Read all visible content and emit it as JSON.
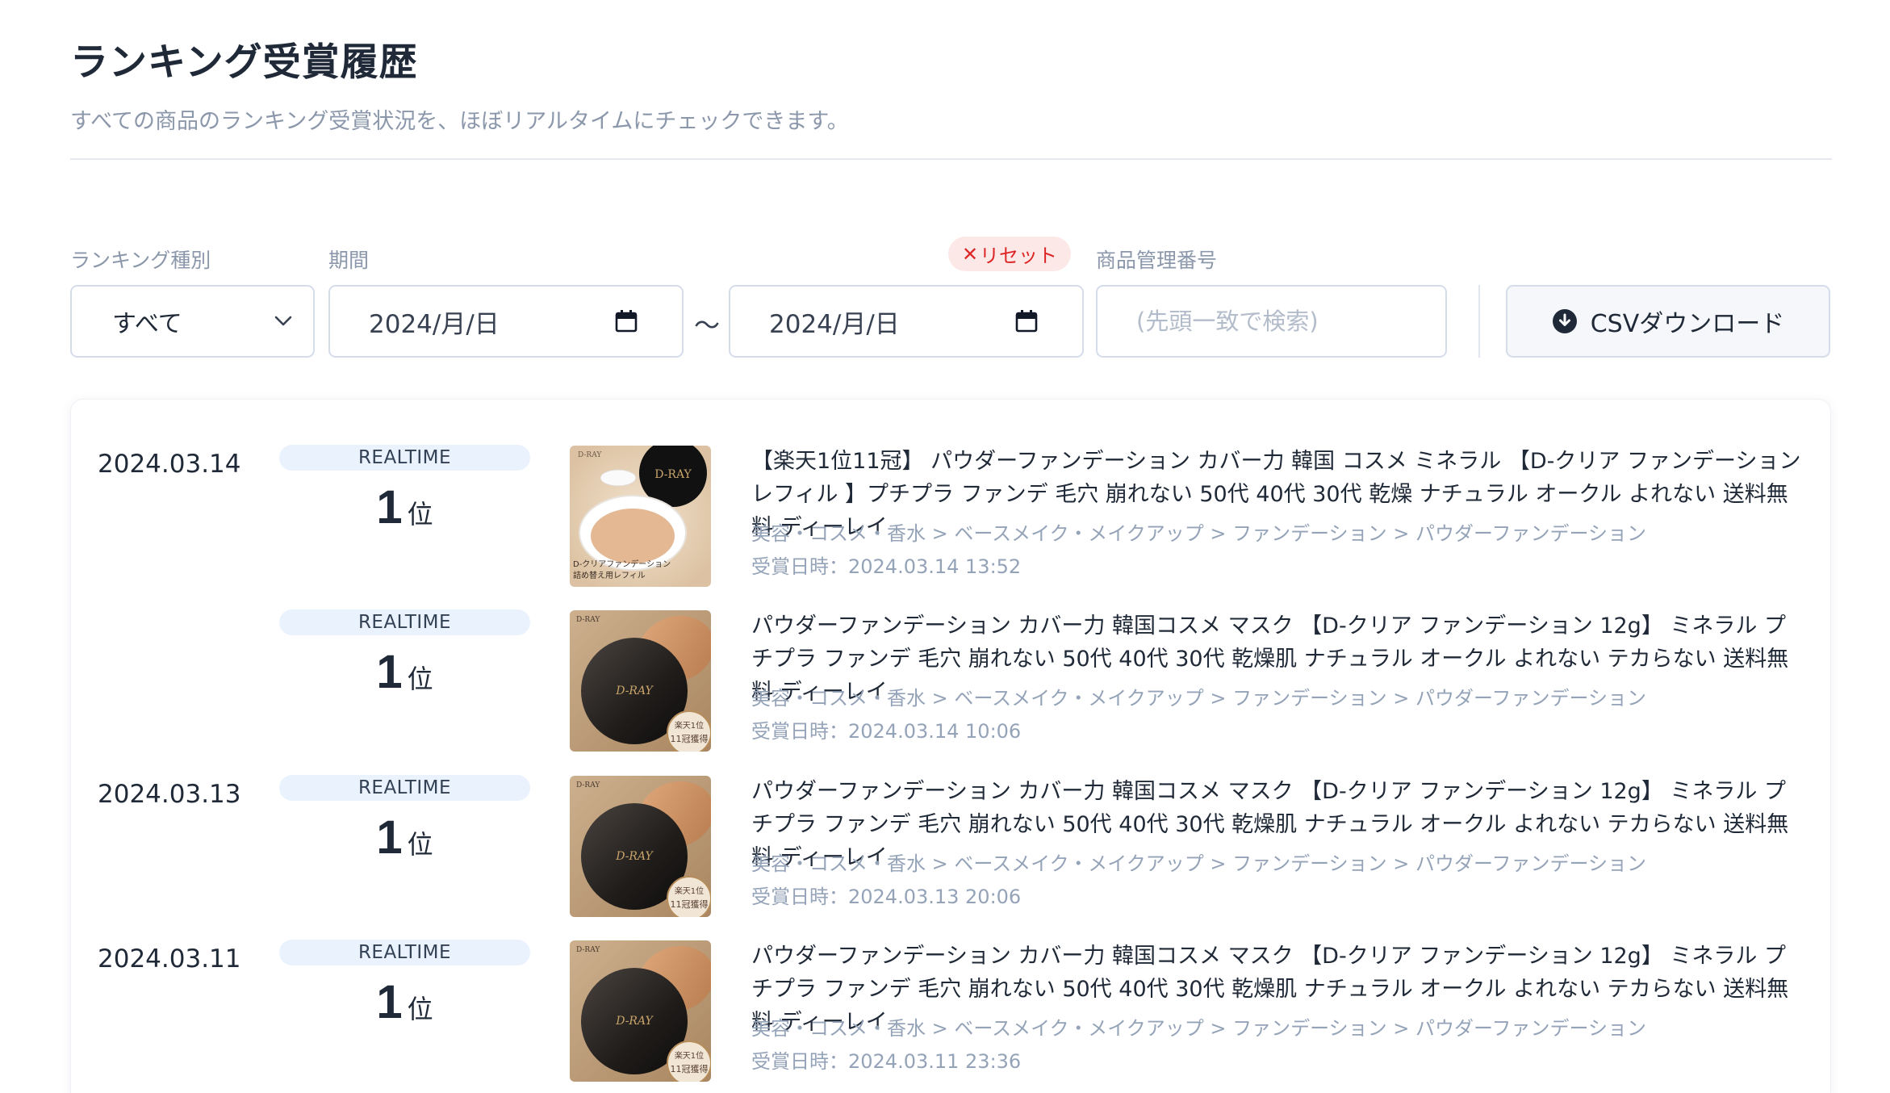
{
  "header": {
    "title": "ランキング受賞履歴",
    "subtitle": "すべての商品のランキング受賞状況を、ほぼリアルタイムにチェックできます。"
  },
  "filters": {
    "ranking_type_label": "ランキング種別",
    "ranking_type_value": "すべて",
    "period_label": "期間",
    "period_start": "2024/月/日",
    "period_end": "2024/月/日",
    "range_separator": "〜",
    "reset_x": "✕",
    "reset_label": "リセット",
    "product_id_label": "商品管理番号",
    "product_id_placeholder": "(先頭一致で検索)",
    "product_id_value": "",
    "csv_label": "CSVダウンロード"
  },
  "icons": {
    "chevron": "chevron-down-icon",
    "calendar": "calendar-icon",
    "download": "download-circle-icon"
  },
  "colors": {
    "reset_text": "#dc2626",
    "reset_bg": "#fde8e8",
    "badge_bg": "#eaf2fd",
    "muted_text": "#94a3b8"
  },
  "entries": [
    {
      "date": "2024.03.14",
      "badge": "REALTIME",
      "rank": "1",
      "rank_unit": "位",
      "image": "product-refill-thumbnail",
      "image_caption_1": "D-クリアファンデーション",
      "image_caption_2": "詰め替え用レフィル",
      "title": "【楽天1位11冠】 パウダーファンデーション カバー力 韓国 コスメ ミネラル 【D-クリア ファンデーション レフィル 】プチプラ ファンデ 毛穴 崩れない 50代 40代 30代 乾燥 ナチュラル オークル よれない 送料無料 ディーレイ",
      "category": "美容・コスメ・香水 > ベースメイク・メイクアップ > ファンデーション > パウダーファンデーション",
      "awarded_at": "受賞日時：2024.03.14 13:52"
    },
    {
      "date": "",
      "badge": "REALTIME",
      "rank": "1",
      "rank_unit": "位",
      "image": "product-compact-thumbnail",
      "image_caption_1": "楽天1位",
      "image_caption_2": "11冠獲得",
      "title": "パウダーファンデーション カバー力 韓国コスメ マスク 【D-クリア ファンデーション 12g】 ミネラル プチプラ ファンデ 毛穴 崩れない 50代 40代 30代 乾燥肌 ナチュラル オークル よれない テカらない 送料無料 ディーレイ",
      "category": "美容・コスメ・香水 > ベースメイク・メイクアップ > ファンデーション > パウダーファンデーション",
      "awarded_at": "受賞日時：2024.03.14 10:06"
    },
    {
      "date": "2024.03.13",
      "badge": "REALTIME",
      "rank": "1",
      "rank_unit": "位",
      "image": "product-compact-thumbnail",
      "image_caption_1": "楽天1位",
      "image_caption_2": "11冠獲得",
      "title": "パウダーファンデーション カバー力 韓国コスメ マスク 【D-クリア ファンデーション 12g】 ミネラル プチプラ ファンデ 毛穴 崩れない 50代 40代 30代 乾燥肌 ナチュラル オークル よれない テカらない 送料無料 ディーレイ",
      "category": "美容・コスメ・香水 > ベースメイク・メイクアップ > ファンデーション > パウダーファンデーション",
      "awarded_at": "受賞日時：2024.03.13 20:06"
    },
    {
      "date": "2024.03.11",
      "badge": "REALTIME",
      "rank": "1",
      "rank_unit": "位",
      "image": "product-compact-thumbnail",
      "image_caption_1": "楽天1位",
      "image_caption_2": "11冠獲得",
      "title": "パウダーファンデーション カバー力 韓国コスメ マスク 【D-クリア ファンデーション 12g】 ミネラル プチプラ ファンデ 毛穴 崩れない 50代 40代 30代 乾燥肌 ナチュラル オークル よれない テカらない 送料無料 ディーレイ",
      "category": "美容・コスメ・香水 > ベースメイク・メイクアップ > ファンデーション > パウダーファンデーション",
      "awarded_at": "受賞日時：2024.03.11 23:36"
    }
  ]
}
